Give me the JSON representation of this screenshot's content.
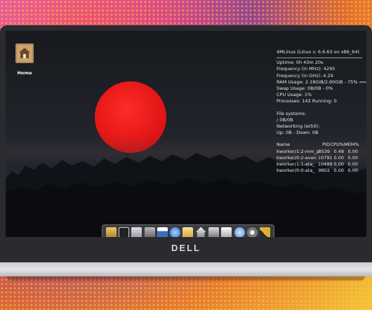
{
  "desktop": {
    "home_label": "Home"
  },
  "conky": {
    "title": "4MLinux (Linux v. 6.6.63 on x86_64)",
    "uptime": "Uptime: 0h 43m 20s",
    "freq_mhz": "Frequency (in MHz): 4295",
    "freq_ghz": "Frequency (in GHz): 4.29",
    "ram": "RAM Usage: 2.18GiB/2.90GiB - 75%",
    "swap": "Swap Usage: 0B/0B - 0%",
    "cpu": "CPU Usage: 1%",
    "processes": "Processes: 142  Running: 0",
    "filesystems_label": "File systems:",
    "fs_root": "/ 0B/0B",
    "networking_label": "Networking (eth0):",
    "net_updown": "Up: 0B  - Down: 0B",
    "proc_headers": [
      "Name",
      "PID",
      "CPU%",
      "MEM%"
    ],
    "procs": [
      [
        "kworker/1:2-mm_p",
        "8539",
        "0.48",
        "0.00"
      ],
      [
        "kworker/0:2-even",
        "10791",
        "0.00",
        "0.00"
      ],
      [
        "kworker/1:1-ata_",
        "10499",
        "0.00",
        "0.00"
      ],
      [
        "kworker/0:0-ata_",
        "9802",
        "0.00",
        "0.00"
      ]
    ]
  },
  "dock": {
    "icons": [
      "files-icon",
      "terminal-icon",
      "editor-icon",
      "calculator-icon",
      "calendar-icon",
      "browser-icon",
      "mail-icon",
      "home-icon",
      "media-icon",
      "photo-icon",
      "network-icon",
      "settings-icon",
      "tools-icon"
    ]
  },
  "brand": {
    "laptop_logo": "DELL"
  },
  "colors": {
    "sun": "#e21616",
    "screen_bg": "#1f2228",
    "text": "#e6e6e6"
  }
}
